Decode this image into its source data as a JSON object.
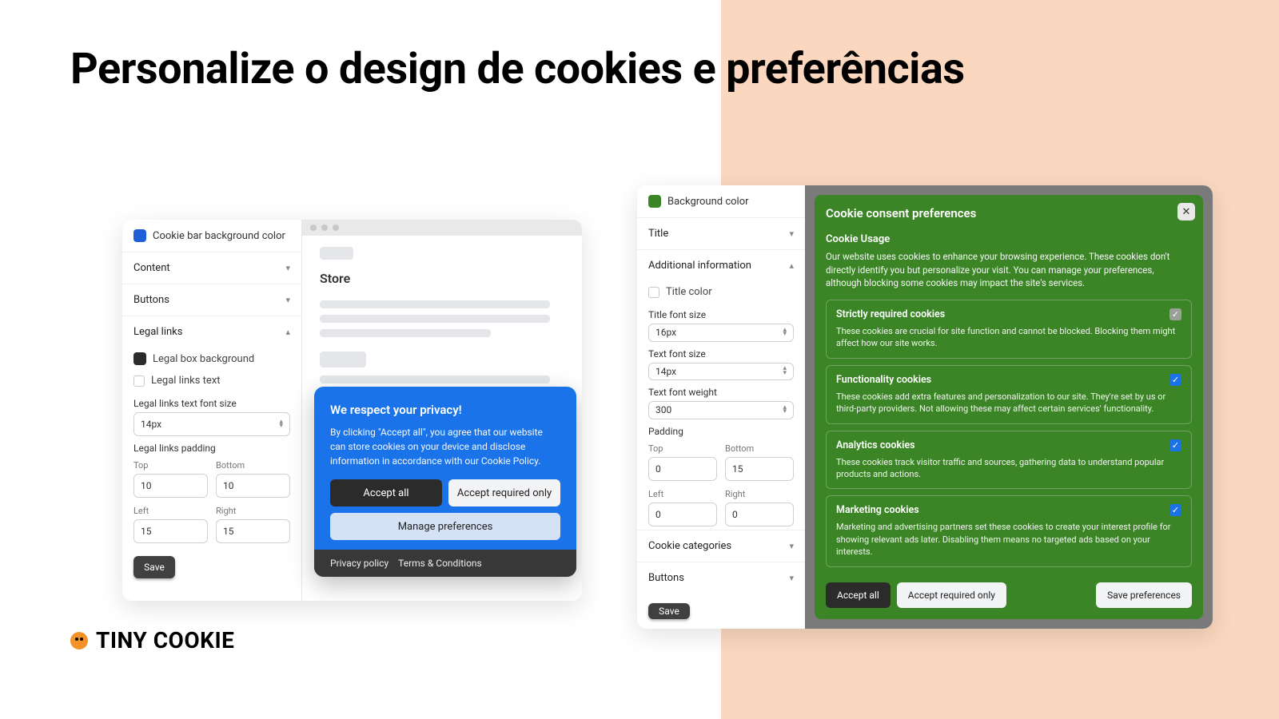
{
  "headline": "Personalize o design de cookies e preferências",
  "brand": "TINY COOKIE",
  "panel1": {
    "swatch_label": "Cookie bar background color",
    "swatch_color": "#1d5fd6",
    "sections": {
      "content": "Content",
      "buttons": "Buttons",
      "legal": "Legal links"
    },
    "legal_box_bg": "Legal box background",
    "legal_box_color": "#2b2b2b",
    "legal_links_text": "Legal links text",
    "legal_font_size_label": "Legal links text font size",
    "legal_font_size": "14px",
    "legal_padding_label": "Legal links padding",
    "pad": {
      "top_lbl": "Top",
      "top": "10",
      "bottom_lbl": "Bottom",
      "bottom": "10",
      "left_lbl": "Left",
      "left": "15",
      "right_lbl": "Right",
      "right": "15"
    },
    "save": "Save",
    "store": "Store"
  },
  "banner": {
    "title": "We respect your privacy!",
    "text": "By clicking \"Accept all\", you agree that our website can store cookies on your device and disclose information in accordance with our Cookie Policy.",
    "accept_all": "Accept all",
    "accept_req": "Accept required only",
    "manage": "Manage preferences",
    "privacy": "Privacy policy",
    "terms": "Terms & Conditions"
  },
  "panel2": {
    "bg_label": "Background color",
    "bg_color": "#3c8527",
    "title_section": "Title",
    "addl_info": "Additional information",
    "title_color_lbl": "Title color",
    "title_font_size_lbl": "Title font size",
    "title_font_size": "16px",
    "text_font_size_lbl": "Text font size",
    "text_font_size": "14px",
    "text_font_weight_lbl": "Text font weight",
    "text_font_weight": "300",
    "padding_lbl": "Padding",
    "pad": {
      "top_lbl": "Top",
      "top": "0",
      "bottom_lbl": "Bottom",
      "bottom": "15",
      "left_lbl": "Left",
      "left": "0",
      "right_lbl": "Right",
      "right": "0"
    },
    "cookie_cats": "Cookie categories",
    "buttons_section": "Buttons",
    "save": "Save"
  },
  "prefs": {
    "title": "Cookie consent preferences",
    "usage_title": "Cookie Usage",
    "usage_text": "Our website uses cookies to enhance your browsing experience. These cookies don't directly identify you but personalize your visit. You can manage your preferences, although blocking some cookies may impact the site's services.",
    "cats": [
      {
        "title": "Strictly required cookies",
        "text": "These cookies are crucial for site function and cannot be blocked. Blocking them might affect how our site works.",
        "locked": true
      },
      {
        "title": "Functionality cookies",
        "text": "These cookies add extra features and personalization to our site. They're set by us or third-party providers. Not allowing these may affect certain services' functionality.",
        "locked": false
      },
      {
        "title": "Analytics cookies",
        "text": "These cookies track visitor traffic and sources, gathering data to understand popular products and actions.",
        "locked": false
      },
      {
        "title": "Marketing cookies",
        "text": "Marketing and advertising partners set these cookies to create your interest profile for showing relevant ads later. Disabling them means no targeted ads based on your interests.",
        "locked": false
      }
    ],
    "accept_all": "Accept all",
    "accept_req": "Accept required only",
    "save_prefs": "Save preferences"
  }
}
